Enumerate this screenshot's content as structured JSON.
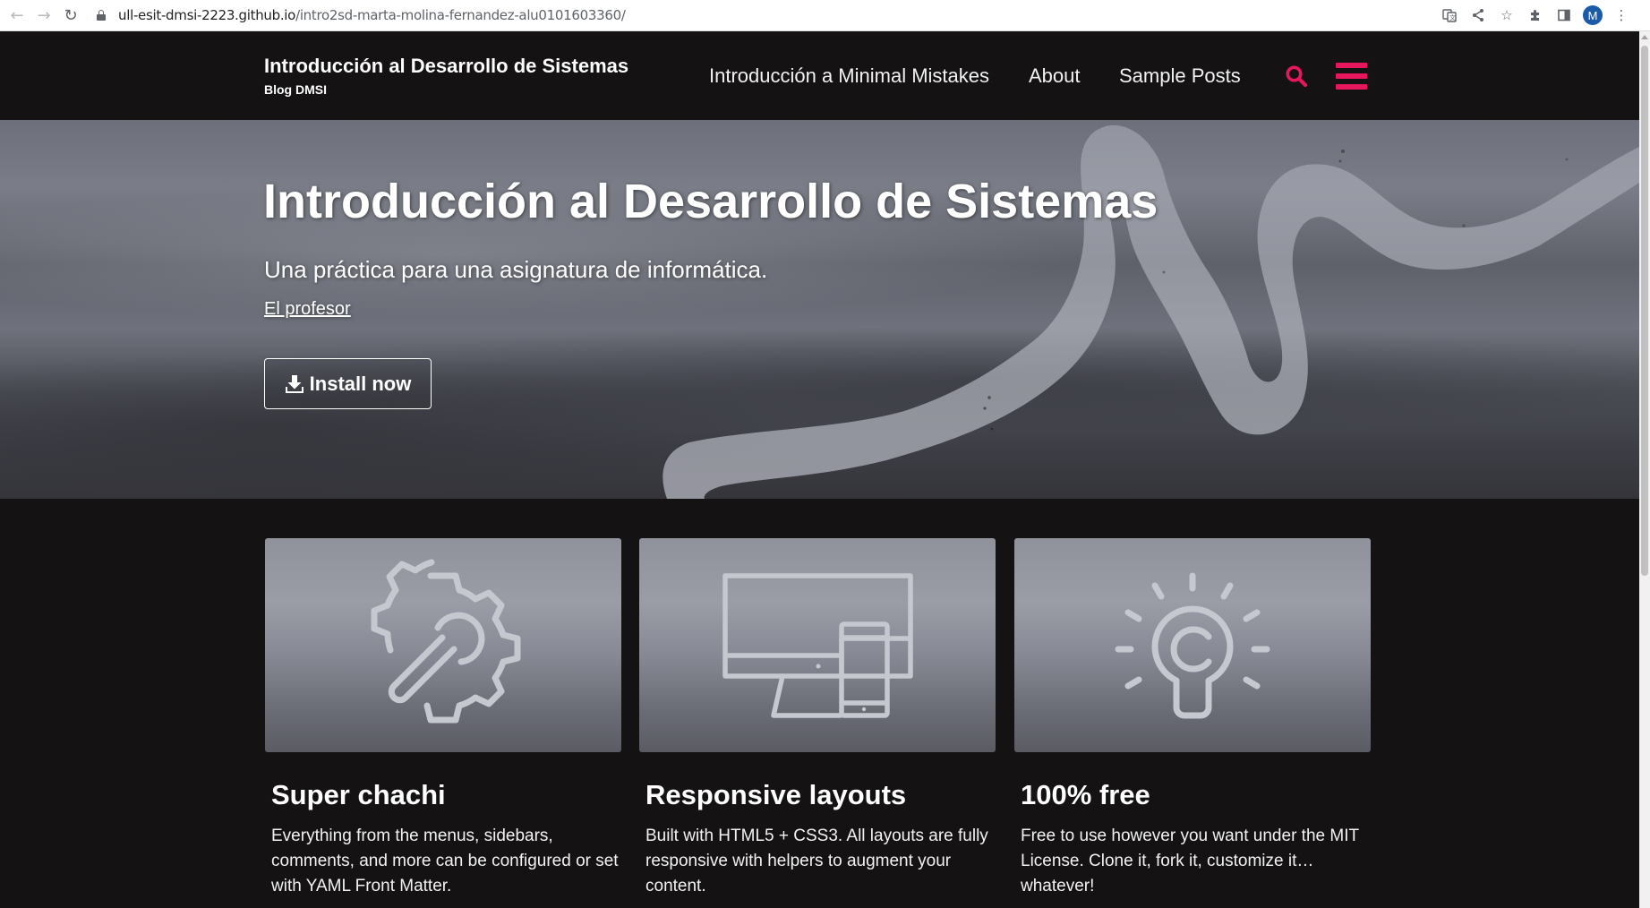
{
  "browser": {
    "url_host": "ull-esit-dmsi-2223.github.io",
    "url_path": "/intro2sd-marta-molina-fernandez-alu0101603360/",
    "profile_initial": "M",
    "icons": [
      "back-icon",
      "forward-icon",
      "reload-icon",
      "lock-icon",
      "translate-icon",
      "share-icon",
      "bookmark-star-icon",
      "extensions-icon",
      "side-panel-icon",
      "kebab-menu-icon"
    ]
  },
  "header": {
    "site_title": "Introducción al Desarrollo de Sistemas",
    "site_subtitle": "Blog DMSI",
    "nav": [
      {
        "label": "Introducción a Minimal Mistakes"
      },
      {
        "label": "About"
      },
      {
        "label": "Sample Posts"
      }
    ],
    "accent_color": "#e8175d"
  },
  "hero": {
    "title": "Introducción al Desarrollo de Sistemas",
    "excerpt": "Una práctica para una asignatura de informática.",
    "link": "El profesor",
    "cta": "Install now"
  },
  "features": [
    {
      "icon": "gear-wrench-icon",
      "title": "Super chachi",
      "text": "Everything from the menus, sidebars, comments, and more can be configured or set with YAML Front Matter."
    },
    {
      "icon": "responsive-devices-icon",
      "title": "Responsive layouts",
      "text": "Built with HTML5 + CSS3. All layouts are fully responsive with helpers to augment your content."
    },
    {
      "icon": "copyright-bulb-icon",
      "title": "100% free",
      "text": "Free to use however you want under the MIT License. Clone it, fork it, customize it… whatever!"
    }
  ]
}
